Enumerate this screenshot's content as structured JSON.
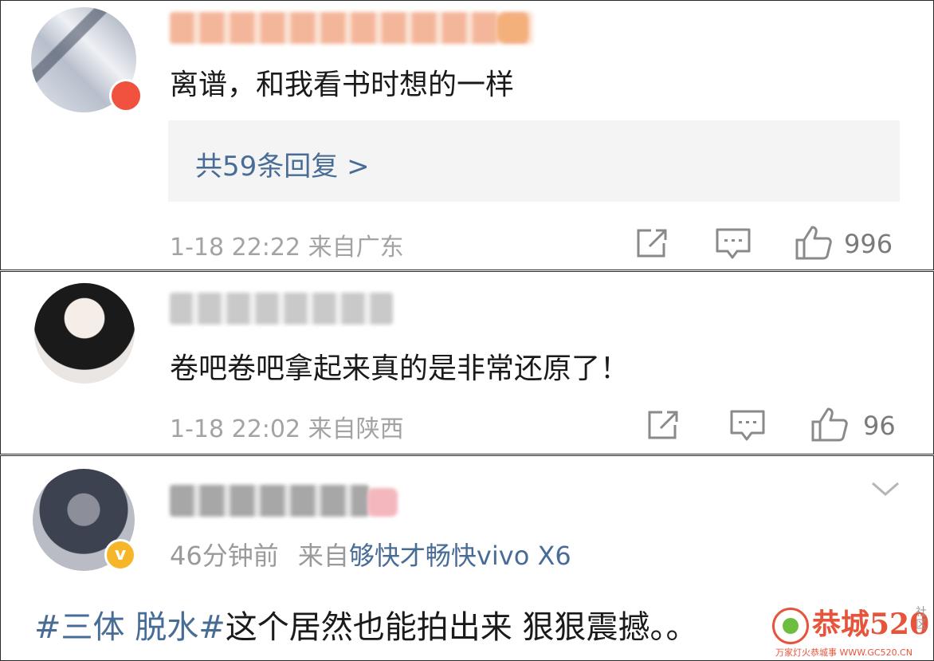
{
  "comments": [
    {
      "text": "离谱，和我看书时想的一样",
      "replies_label": "共59条回复 >",
      "time": "1-18 22:22",
      "location": "来自广东",
      "likes": "996"
    },
    {
      "text": "卷吧卷吧拿起来真的是非常还原了！",
      "time": "1-18 22:02",
      "location": "来自陕西",
      "likes": "96"
    }
  ],
  "post": {
    "time": "46分钟前",
    "source_prefix": "来自",
    "device": "够快才畅快vivo X6",
    "hashtag": "#三体 脱水#",
    "text": "这个居然也能拍出来 狠狠震撼。。"
  },
  "watermark": {
    "main": "恭城520",
    "side": "社区",
    "url": "WWW.GC520.CN",
    "slogan": "万家灯火恭城事"
  },
  "colors": {
    "link_blue": "#476c96",
    "meta_gray": "#a3a3a3",
    "reply_bg": "#f4f4f4",
    "badge_red": "#f0523f",
    "badge_gold": "#f5b629"
  },
  "icons": [
    "share-icon",
    "comment-icon",
    "like-icon",
    "chevron-down-icon",
    "verified-badge-icon"
  ]
}
